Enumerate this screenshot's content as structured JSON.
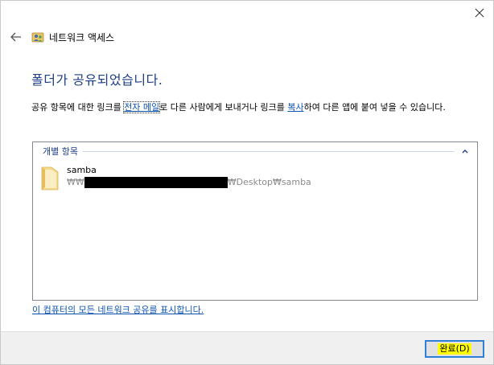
{
  "window": {
    "title": "네트워크 액세스"
  },
  "heading": "폴더가 공유되었습니다.",
  "description": {
    "part1": "공유 항목에 대한 링크를 ",
    "email_link": "전자 메일",
    "part2": "로 다른 사람에게 보내거나 링크를 ",
    "copy_link": "복사",
    "part3": "하여 다른 앱에 붙여 넣을 수 있습니다."
  },
  "group": {
    "title": "개별 항목"
  },
  "items": [
    {
      "name": "samba",
      "path_prefix": "₩₩",
      "path_suffix": "₩Desktop₩samba"
    }
  ],
  "show_all_link": "이 컴퓨터의 모든 네트워크 공유를 표시합니다.",
  "finish_button": "완료(D)",
  "colors": {
    "heading": "#1e3d87",
    "link": "#0a52b2",
    "footer_bg": "#f0f0f0",
    "button_focus_border": "#2e7fd8",
    "highlight": "#ffff00"
  }
}
